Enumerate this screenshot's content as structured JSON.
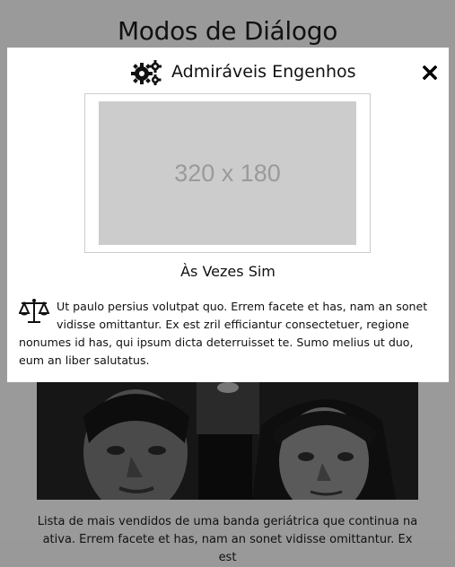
{
  "page": {
    "title": "Modos de Diálogo",
    "text_line1": "Lista de mais vendidos de uma banda geriátrica que continua na",
    "text_line2": "ativa. Errem facete et has, nam an sonet vidisse omittantur. Ex est"
  },
  "dialog": {
    "title": "Admiráveis Engenhos",
    "thumbnail_label": "320 x 180",
    "caption": "Às Vezes Sim",
    "body": "Ut paulo persius volutpat quo. Errem facete et has, nam an sonet vidisse omittantur. Ex est zril efficiantur consectetuer, regione nonumes id has, qui ipsum dicta deterruisset te. Sumo melius ut duo, eum an liber salutatus."
  },
  "icons": {
    "header": "gears-icon",
    "close": "close-icon",
    "body": "balance-scale-icon"
  }
}
